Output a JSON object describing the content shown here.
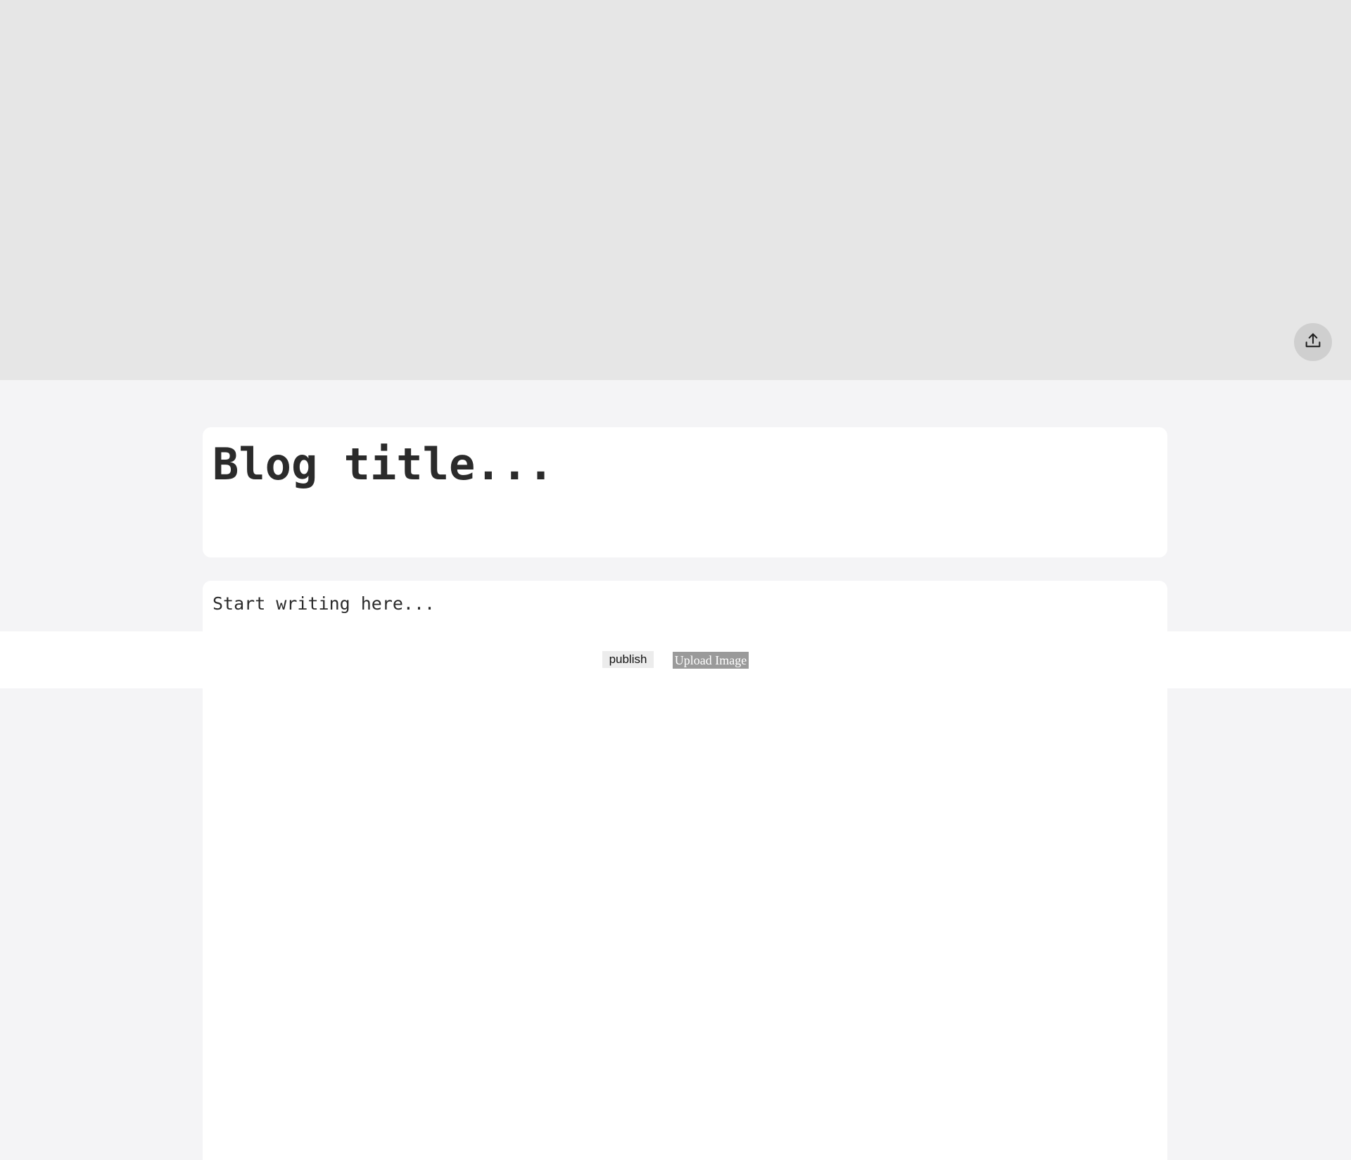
{
  "banner": {
    "upload_icon": "upload-icon"
  },
  "editor": {
    "title_placeholder": "Blog title...",
    "body_placeholder": "Start writing here..."
  },
  "toolbar": {
    "publish_label": "publish",
    "upload_image_label": "Upload Image"
  },
  "colors": {
    "banner_bg": "#e6e6e6",
    "page_bg": "#f4f4f6",
    "card_bg": "#ffffff",
    "upload_button_bg": "#9a9a9a"
  }
}
